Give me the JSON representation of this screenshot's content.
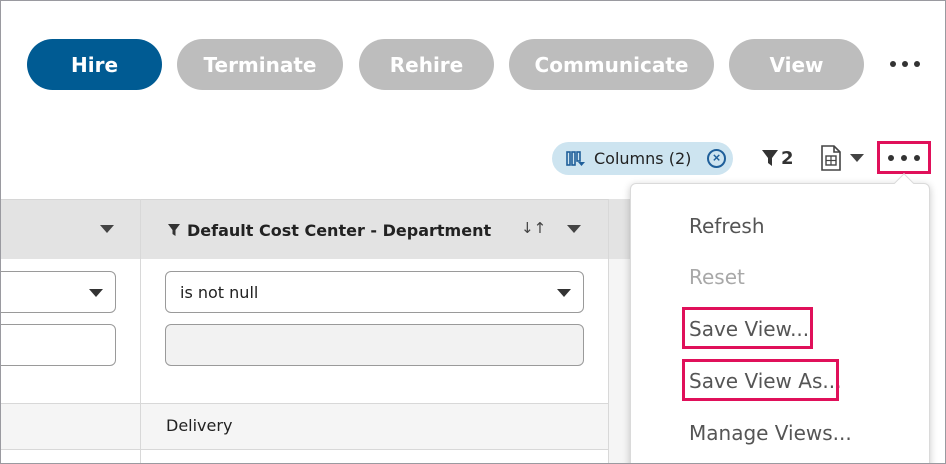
{
  "actions": {
    "hire": "Hire",
    "terminate": "Terminate",
    "rehire": "Rehire",
    "communicate": "Communicate",
    "view": "View",
    "more_icon": "more-horizontal-icon"
  },
  "toolbar": {
    "columns_chip": "Columns (2)",
    "filter_count": "2",
    "filter_icon": "filter-icon",
    "export_icon": "spreadsheet-icon",
    "more_icon": "more-horizontal-icon"
  },
  "grid": {
    "column_header": "Default Cost Center - Department",
    "filter_operator": "is not null",
    "row_value": "Delivery"
  },
  "menu": {
    "items": [
      {
        "label": "Refresh",
        "enabled": true
      },
      {
        "label": "Reset",
        "enabled": false
      },
      {
        "label": "Save View...",
        "enabled": true,
        "highlighted": true
      },
      {
        "label": "Save View As...",
        "enabled": true,
        "highlighted": true
      },
      {
        "label": "Manage Views...",
        "enabled": true
      }
    ]
  },
  "colors": {
    "primary": "#005b93",
    "disabled": "#bdbdbd",
    "highlight": "#e0105a",
    "chip": "#cde4f0"
  }
}
